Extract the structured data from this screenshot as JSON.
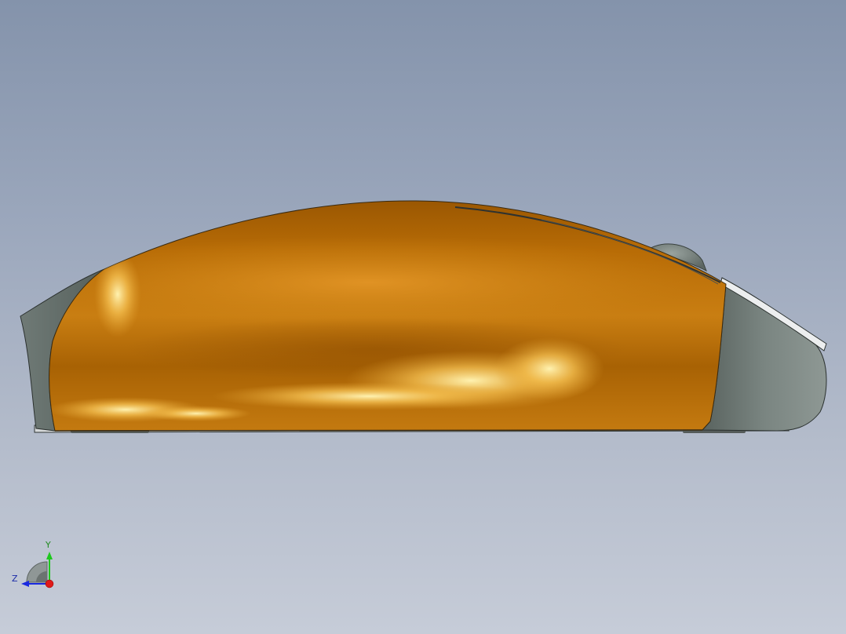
{
  "viewport": {
    "background_top": "#8493ab",
    "background_bottom": "#c6ccd8"
  },
  "model": {
    "object": "computer-mouse-side-view",
    "shell_color": "#b86c06",
    "highlight_color": "#ffd870",
    "base_color": "#6b7672",
    "wheel_color": "#707a76",
    "trim_color": "#e6e8ea"
  },
  "triad": {
    "y_label": "Y",
    "z_label": "Z",
    "y_color": "#1ec81e",
    "z_color": "#1a2ae0",
    "x_color": "#e01a1a"
  }
}
